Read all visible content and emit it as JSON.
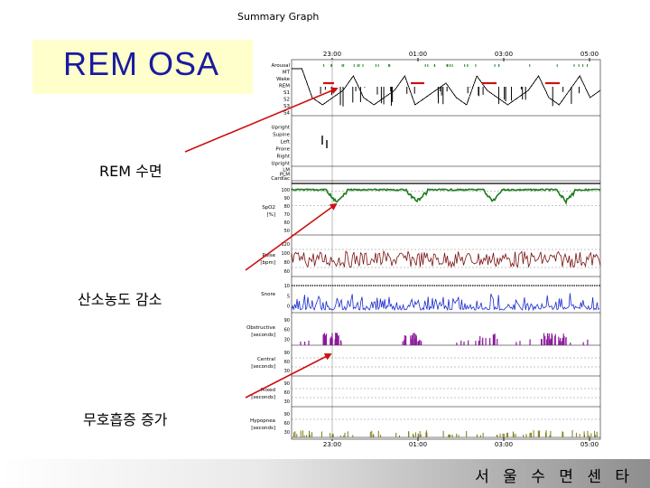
{
  "title_box": {
    "text": "REM OSA"
  },
  "graph_title": "Summary Graph",
  "annotations": [
    {
      "id": "rem",
      "text": "REM 수면"
    },
    {
      "id": "spo2",
      "text": "산소농도 감소"
    },
    {
      "id": "apnea",
      "text": "무호흡증 증가"
    }
  ],
  "footer": "서 울 수 면 센 타",
  "colors": {
    "spo2": "#1e7a1e",
    "pulse": "#7a1010",
    "snore": "#1a2ccc",
    "obstructive": "#8a1a9a",
    "hypopnea": "#7a7a1a",
    "arrow": "#cc1111",
    "highlight": "#cc1111",
    "title_bg": "#ffffcc"
  },
  "chart_data": {
    "type": "line",
    "title": "Summary Graph",
    "time_ticks": [
      "23:00",
      "01:00",
      "03:00",
      "05:00"
    ],
    "panels": [
      {
        "id": "hypnogram",
        "labels": [
          "Arousal",
          "MT",
          "Wake",
          "REM",
          "S1",
          "S2",
          "S3",
          "S4"
        ],
        "rem_periods": 4
      },
      {
        "id": "position",
        "labels": [
          "Upright",
          "Supine",
          "Left",
          "Prone",
          "Right",
          "Upright"
        ]
      },
      {
        "id": "misc",
        "labels": [
          "LM",
          "PLM",
          "Cardiac"
        ]
      },
      {
        "id": "spo2",
        "labels": [
          "SpO2",
          "[%]"
        ],
        "ticks": [
          "100",
          "90",
          "80",
          "70",
          "60",
          "50"
        ],
        "ylim": [
          50,
          100
        ],
        "dips_at_rem": true
      },
      {
        "id": "pulse",
        "labels": [
          "Pulse",
          "[bpm]"
        ],
        "ticks": [
          "120",
          "100",
          "80",
          "60"
        ],
        "ylim": [
          60,
          120
        ]
      },
      {
        "id": "snore",
        "labels": [
          "Snore"
        ],
        "ticks": [
          "10",
          "5",
          "0"
        ]
      },
      {
        "id": "obstructive",
        "labels": [
          "Obstructive",
          "[seconds]"
        ],
        "ticks": [
          "90",
          "60",
          "30"
        ]
      },
      {
        "id": "central",
        "labels": [
          "Central",
          "[seconds]"
        ],
        "ticks": [
          "90",
          "60",
          "30"
        ]
      },
      {
        "id": "mixed",
        "labels": [
          "Mixed",
          "[seconds]"
        ],
        "ticks": [
          "90",
          "60",
          "30"
        ]
      },
      {
        "id": "hypopnea",
        "labels": [
          "Hypopnea",
          "[seconds]"
        ],
        "ticks": [
          "90",
          "60",
          "30"
        ]
      }
    ]
  }
}
